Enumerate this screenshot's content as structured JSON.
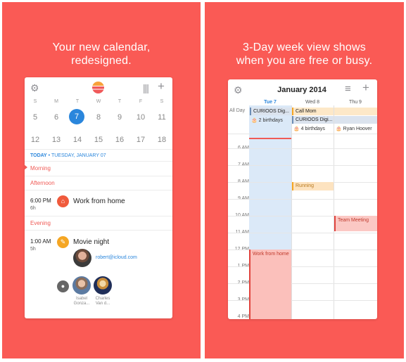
{
  "left_panel": {
    "headline": [
      "Your new calendar,",
      "redesigned."
    ],
    "weekdays": [
      "S",
      "M",
      "T",
      "W",
      "T",
      "F",
      "S"
    ],
    "week1": [
      "5",
      "6",
      "7",
      "8",
      "9",
      "10",
      "11"
    ],
    "week2": [
      "12",
      "13",
      "14",
      "15",
      "16",
      "17",
      "18"
    ],
    "today_label": "TODAY",
    "today_date": " • TUESDAY, JANUARY 07",
    "sections": {
      "morning": "Morning",
      "afternoon": "Afternoon",
      "evening": "Evening"
    },
    "events": [
      {
        "time": "6:00 PM",
        "duration": "6h",
        "title": "Work from home",
        "icon": "home-icon"
      },
      {
        "time": "1:00 AM",
        "duration": "5h",
        "title": "Movie night",
        "icon": "ticket-icon",
        "attendee_email": "robert@icloud.com"
      }
    ],
    "attendees": [
      {
        "name": "Isabel Gonza..."
      },
      {
        "name": "Charles Van d..."
      }
    ]
  },
  "right_panel": {
    "headline": [
      "3-Day week view shows",
      "when you are free or busy."
    ],
    "month_title": "January 2014",
    "days": [
      "Tue 7",
      "Wed 8",
      "Thu 9"
    ],
    "all_day_label": "All Day",
    "all_day_events": [
      {
        "text": "CURIOOS Dig..."
      },
      {
        "text": "Call Mom"
      },
      {
        "text": "CURIOOS Digi..."
      },
      {
        "text": "2 birthdays"
      },
      {
        "text": "4 birthdays"
      },
      {
        "text": "Ryan Hoover"
      }
    ],
    "hours": [
      "6 AM",
      "7 AM",
      "8 AM",
      "9 AM",
      "10 AM",
      "11 AM",
      "12 PM",
      "1 PM",
      "2 PM",
      "3 PM",
      "4 PM"
    ],
    "events": [
      {
        "title": "Running"
      },
      {
        "title": "Team Meeting"
      },
      {
        "title": "Work from home"
      }
    ]
  },
  "colors": {
    "background": "#fa5a55",
    "accent_blue": "#2a86dc",
    "accent_red": "#f05a55"
  }
}
